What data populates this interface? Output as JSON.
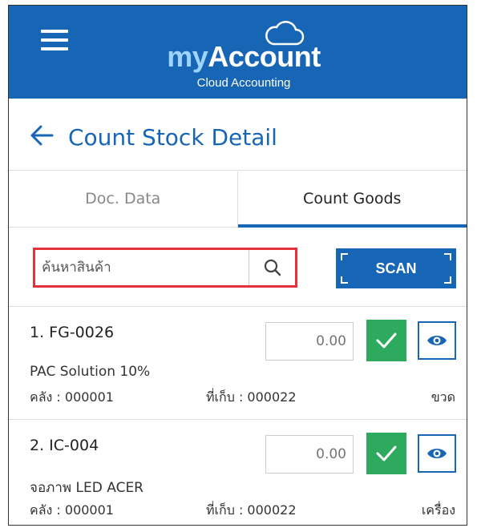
{
  "app": {
    "logo_my": "my",
    "logo_account": "Account",
    "logo_sub": "Cloud Accounting"
  },
  "header": {
    "title": "Count Stock Detail"
  },
  "tabs": [
    {
      "label": "Doc. Data",
      "active": false
    },
    {
      "label": "Count Goods",
      "active": true
    }
  ],
  "search": {
    "placeholder": "ค้นหาสินค้า",
    "scan_label": "SCAN"
  },
  "items": [
    {
      "title": "1. FG-0026",
      "qty_placeholder": "0.00",
      "name": "PAC Solution 10%",
      "warehouse": "คลัง : 000001",
      "location": "ที่เก็บ : 000022",
      "unit": "ขวด"
    },
    {
      "title": "2. IC-004",
      "qty_placeholder": "0.00",
      "name": "จอภาพ LED ACER",
      "warehouse": "คลัง : 000001",
      "location": "ที่เก็บ : 000022",
      "unit": "เครื่อง"
    }
  ],
  "colors": {
    "brand": "#1766b5",
    "confirm": "#2eaa5e",
    "highlight": "#e53238"
  },
  "icons": {
    "menu": "hamburger-icon",
    "logo": "cloud-icon",
    "back": "arrow-left-icon",
    "search": "magnifier-icon",
    "confirm": "checkmark-icon",
    "view": "eye-icon"
  }
}
